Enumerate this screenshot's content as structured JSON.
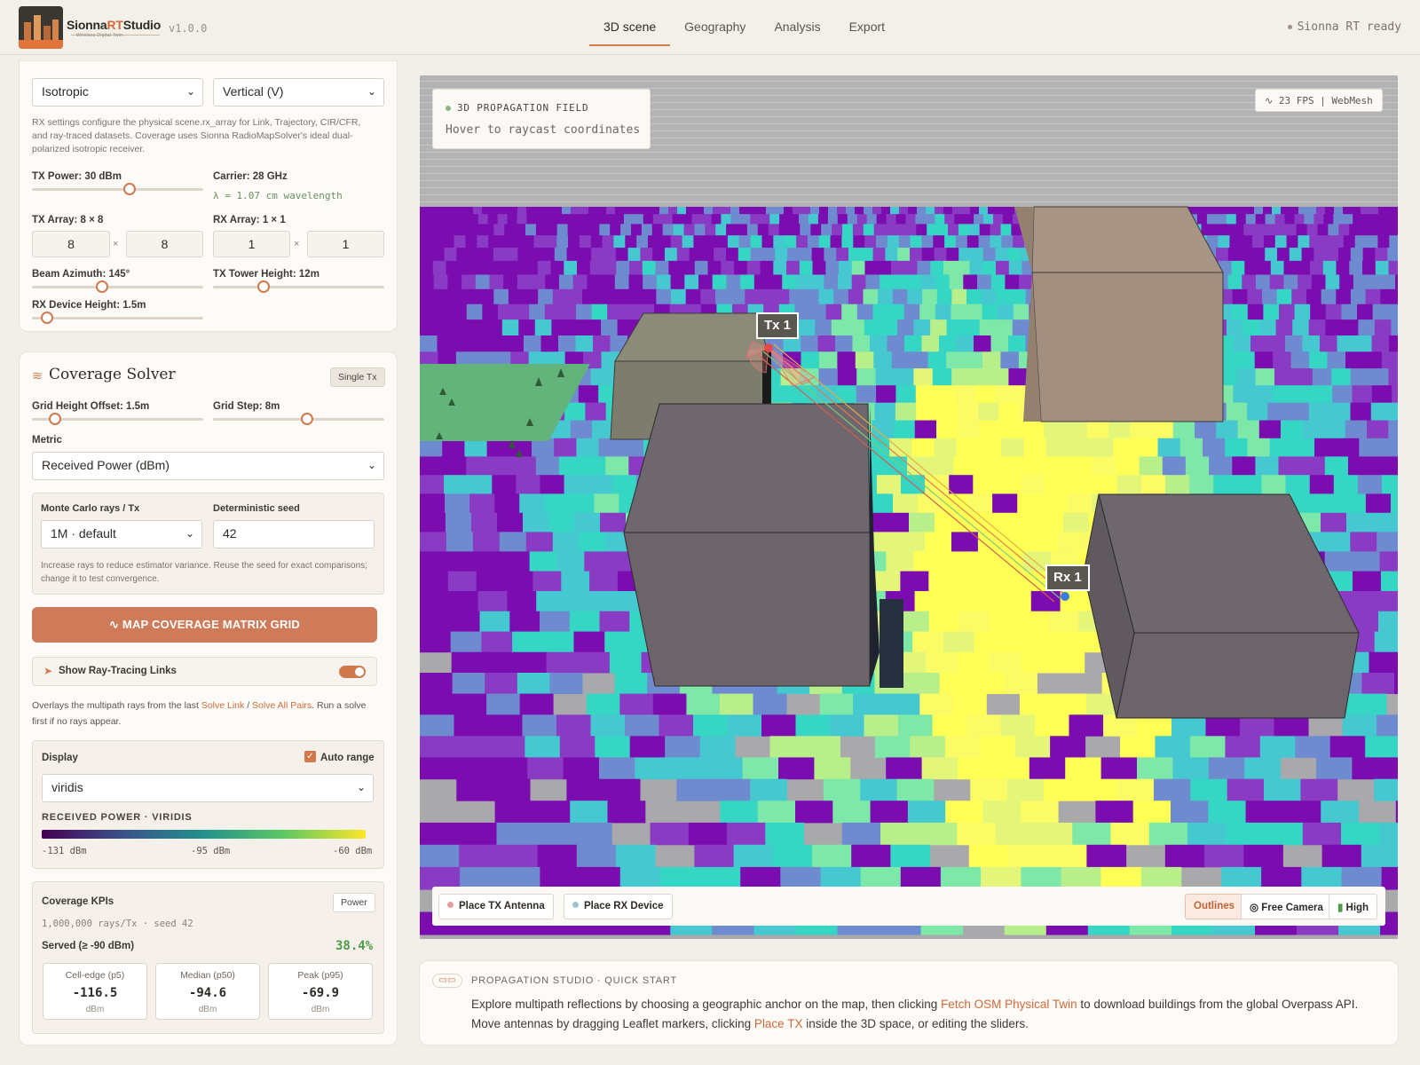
{
  "header": {
    "brand_main": "Sionna",
    "brand_rt": "RT",
    "brand_studio": "Studio",
    "brand_sub": "Wireless Digital Twin",
    "version": "v1.0.0",
    "tabs": [
      {
        "label": "3D scene",
        "active": true
      },
      {
        "label": "Geography",
        "active": false
      },
      {
        "label": "Analysis",
        "active": false
      },
      {
        "label": "Export",
        "active": false
      }
    ],
    "status": "Sionna RT ready"
  },
  "rx_panel": {
    "pattern_select": "Isotropic",
    "polarization_select": "Vertical (V)",
    "help": "RX settings configure the physical scene.rx_array for Link, Trajectory, CIR/CFR, and ray-traced datasets. Coverage uses Sionna RadioMapSolver's ideal dual-polarized isotropic receiver.",
    "tx_power_label": "TX Power: 30 dBm",
    "tx_power_value": 0.57,
    "carrier_label": "Carrier: 28 GHz",
    "wavelength": "λ = 1.07 cm wavelength",
    "tx_array_label": "TX Array: 8 × 8",
    "tx_array_rows": "8",
    "tx_array_cols": "8",
    "rx_array_label": "RX Array: 1 × 1",
    "rx_array_rows": "1",
    "rx_array_cols": "1",
    "times": "×",
    "beam_azimuth_label": "Beam Azimuth: 145°",
    "tower_height_label": "TX Tower Height: 12m",
    "rx_height_label": "RX Device Height: 1.5m"
  },
  "coverage": {
    "title": "Coverage Solver",
    "badge": "Single Tx",
    "grid_height_label": "Grid Height Offset: 1.5m",
    "grid_step_label": "Grid Step: 8m",
    "metric_label": "Metric",
    "metric_value": "Received Power (dBm)",
    "mc_label": "Monte Carlo rays / Tx",
    "mc_value": "1M · default",
    "seed_label": "Deterministic seed",
    "seed_value": "42",
    "mc_help": "Increase rays to reduce estimator variance. Reuse the seed for exact comparisons; change it to test convergence.",
    "map_button": "MAP COVERAGE MATRIX GRID",
    "ray_toggle_label": "Show Ray-Tracing Links",
    "ray_toggle_on": true,
    "overlay_help_1": "Overlays the multipath rays from the last ",
    "overlay_link_1": "Solve Link",
    "overlay_sep": " / ",
    "overlay_link_2": "Solve All Pairs",
    "overlay_help_2": ". Run a solve first if no rays appear.",
    "display_label": "Display",
    "auto_range_label": "Auto range",
    "auto_range_checked": true,
    "colormap": "viridis",
    "legend_title": "RECEIVED POWER · VIRIDIS",
    "legend_min": "-131 dBm",
    "legend_mid": "-95 dBm",
    "legend_max": "-60 dBm",
    "kpi_title": "Coverage KPIs",
    "kpi_badge": "Power",
    "kpi_meta": "1,000,000 rays/Tx · seed 42",
    "served_label": "Served (≥ -90 dBm)",
    "served_value": "38.4%",
    "kpis": [
      {
        "title": "Cell-edge (p5)",
        "value": "-116.5",
        "unit": "dBm"
      },
      {
        "title": "Median (p50)",
        "value": "-94.6",
        "unit": "dBm"
      },
      {
        "title": "Peak (p95)",
        "value": "-69.9",
        "unit": "dBm"
      }
    ]
  },
  "viewport": {
    "info_title": "3D PROPAGATION FIELD",
    "info_hint": "Hover to raycast coordinates",
    "fps": "23 FPS | WebMesh",
    "tx_label": "Tx 1",
    "rx_label": "Rx 1",
    "toolbar": {
      "place_tx": "Place TX Antenna",
      "place_rx": "Place RX Device",
      "outlines": "Outlines",
      "free_camera": "Free Camera",
      "quality": "High"
    },
    "colors": {
      "tx": "#e8a09a",
      "rx": "#9ec5cf"
    }
  },
  "quickstart": {
    "icon": "book-icon",
    "title": "PROPAGATION STUDIO · QUICK START",
    "text_1": "Explore multipath reflections by choosing a geographic anchor on the map, then clicking ",
    "link_1": "Fetch OSM Physical Twin",
    "text_2": " to download buildings from the global Overpass API. Move antennas by dragging Leaflet markers, clicking ",
    "link_2": "Place TX",
    "text_3": " inside the 3D space, or editing the sliders."
  }
}
